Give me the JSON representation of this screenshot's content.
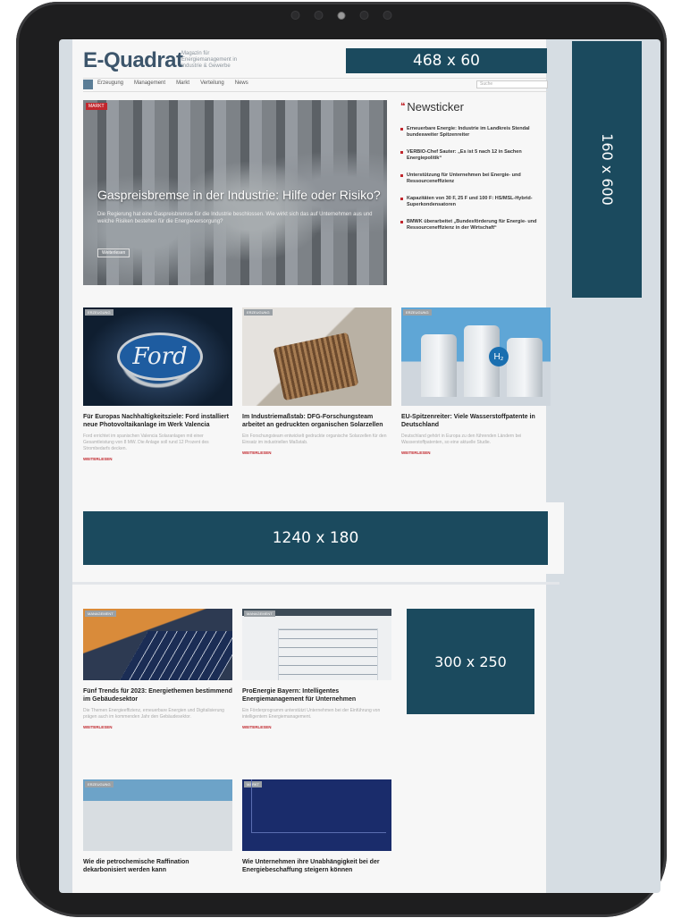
{
  "site": {
    "logo": "E-Quadrat",
    "tagline": "Magazin für Energiemanagement in Industrie & Gewerbe"
  },
  "ads": {
    "top": "468 x 60",
    "side": "160 x 600",
    "wide": "1240 x 180",
    "mid": "300 x 250"
  },
  "nav": {
    "items": [
      "Erzeugung",
      "Management",
      "Markt",
      "Verteilung",
      "News"
    ],
    "search_placeholder": "Suche"
  },
  "hero": {
    "tag": "MARKT",
    "title": "Gaspreisbremse in der Industrie: Hilfe oder Risiko?",
    "text": "Die Regierung hat eine Gaspreisbremse für die Industrie beschlossen. Wie wirkt sich das auf Unternehmen aus und welche Risiken bestehen für die Energieversorgung?",
    "more": "Weiterlesen"
  },
  "ticker": {
    "title": "Newsticker",
    "items": [
      "Erneuerbare Energie: Industrie im Landkreis Stendal bundesweiter Spitzenreiter",
      "VERBIO-Chef Sauter: „Es ist 5 nach 12 in Sachen Energiepolitik“",
      "Unterstützung für Unternehmen bei Energie- und Ressourceneffizienz",
      "Kapazitäten von 30 F, 25 F und 100 F: HS/MSL-Hybrid-Superkondensatoren",
      "BMWK überarbeitet „Bundesförderung für Energie- und Ressourceneffizienz in der Wirtschaft“"
    ]
  },
  "cards": [
    {
      "tag": "ERZEUGUNG",
      "title": "Für Europas Nachhaltigkeitsziele: Ford installiert neue Photovoltaikanlage im Werk Valencia",
      "excerpt": "Ford errichtet im spanischen Valencia Solaranlagen mit einer Gesamtleistung von 8 MW. Die Anlage soll rund 12 Prozent des Strombedarfs decken.",
      "more": "WEITERLESEN"
    },
    {
      "tag": "ERZEUGUNG",
      "title": "Im Industriemaßstab: DFG-Forschungsteam arbeitet an gedruckten organischen Solarzellen",
      "excerpt": "Ein Forschungsteam entwickelt gedruckte organische Solarzellen für den Einsatz im industriellen Maßstab.",
      "more": "WEITERLESEN"
    },
    {
      "tag": "ERZEUGUNG",
      "title": "EU-Spitzenreiter: Viele Wasserstoffpatente in Deutschland",
      "excerpt": "Deutschland gehört in Europa zu den führenden Ländern bei Wasserstoffpatenten, so eine aktuelle Studie.",
      "more": "WEITERLESEN"
    },
    {
      "tag": "MANAGEMENT",
      "title": "Fünf Trends für 2023: Energiethemen bestimmend im Gebäudesektor",
      "excerpt": "Die Themen Energieeffizienz, erneuerbare Energien und Digitalisierung prägen auch im kommenden Jahr den Gebäudesektor.",
      "more": "WEITERLESEN"
    },
    {
      "tag": "MANAGEMENT",
      "title": "ProEnergie Bayern: Intelligentes Energiemanagement für Unternehmen",
      "excerpt": "Ein Förderprogramm unterstützt Unternehmen bei der Einführung von intelligentem Energiemanagement.",
      "more": "WEITERLESEN"
    },
    {
      "tag": "ERZEUGUNG",
      "title": "Wie die petrochemische Raffination dekarbonisiert werden kann",
      "excerpt": "",
      "more": ""
    },
    {
      "tag": "MARKT",
      "title": "Wie Unternehmen ihre Unabhängigkeit bei der Energiebeschaffung steigern können",
      "excerpt": "",
      "more": ""
    }
  ]
}
